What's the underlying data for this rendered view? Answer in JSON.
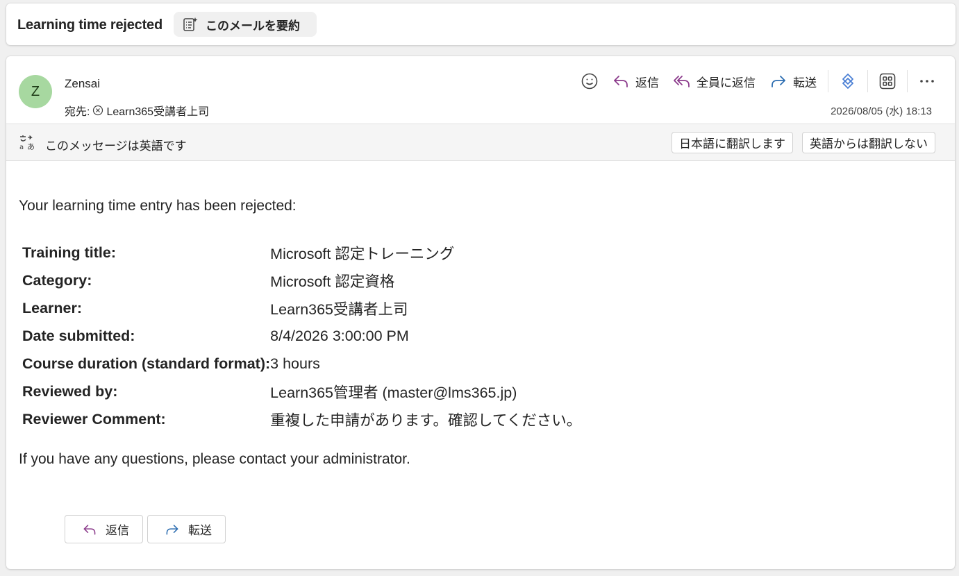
{
  "subject_bar": {
    "subject": "Learning time rejected",
    "summarize_label": "このメールを要約"
  },
  "message": {
    "avatar_initial": "Z",
    "sender": "Zensai",
    "to_prefix": "宛先:",
    "to_recipient": "Learn365受講者上司",
    "date": "2026/08/05 (水) 18:13",
    "actions": {
      "reply": "返信",
      "reply_all": "全員に返信",
      "forward": "転送"
    },
    "translate": {
      "message": "このメッセージは英語です",
      "translate_button": "日本語に翻訳します",
      "never_translate_button": "英語からは翻訳しない"
    },
    "body": {
      "intro": "Your learning time entry has been rejected:",
      "details": [
        {
          "label": "Training title:",
          "value": "Microsoft 認定トレーニング"
        },
        {
          "label": "Category:",
          "value": "Microsoft 認定資格"
        },
        {
          "label": "Learner:",
          "value": "Learn365受講者上司"
        },
        {
          "label": "Date submitted:",
          "value": "8/4/2026 3:00:00 PM"
        },
        {
          "label": "Course duration (standard format):",
          "value": "3 hours"
        },
        {
          "label": "Reviewed by:",
          "value": "Learn365管理者 (master@lms365.jp)"
        },
        {
          "label": "Reviewer Comment:",
          "value": "重複した申請があります。確認してください。"
        }
      ],
      "outro": "If you have any questions, please contact your administrator."
    },
    "footer": {
      "reply": "返信",
      "forward": "転送"
    }
  },
  "colors": {
    "avatar_bg": "#a7d8a0",
    "reply_icon": "#8b3a8b",
    "forward_icon": "#2b6cb0",
    "loop_icon": "#4a7fd4"
  },
  "icons": [
    "summary-icon",
    "emoji-icon",
    "reply-icon",
    "reply-all-icon",
    "forward-icon",
    "loop-icon",
    "apps-icon",
    "more-icon",
    "translate-icon",
    "dismiss-circle-icon"
  ]
}
